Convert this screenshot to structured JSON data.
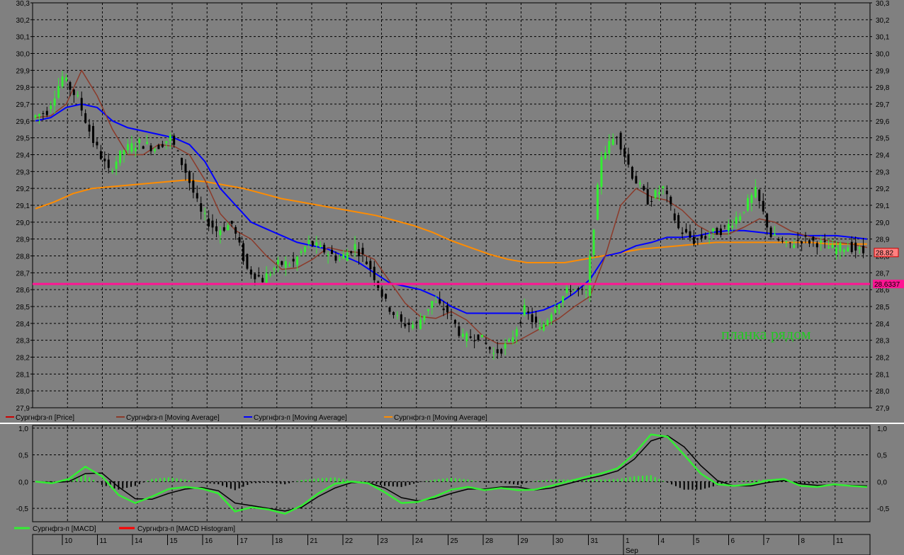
{
  "chart_data": [
    {
      "type": "candlestick",
      "panel": "price",
      "ylim": [
        27.9,
        30.3
      ],
      "yticks": [
        "27,9",
        "28,0",
        "28,1",
        "28,2",
        "28,3",
        "28,4",
        "28,5",
        "28,6",
        "28,7",
        "28,8",
        "28,9",
        "29,0",
        "29,1",
        "29,2",
        "29,3",
        "29,4",
        "29,5",
        "29,6",
        "29,7",
        "29,8",
        "29,9",
        "30,0",
        "30,1",
        "30,2",
        "30,3"
      ],
      "grid": true,
      "price_close": [
        29.62,
        29.66,
        29.86,
        29.73,
        29.48,
        29.3,
        29.43,
        29.47,
        29.44,
        29.5,
        29.3,
        29.05,
        28.95,
        28.99,
        28.72,
        28.66,
        28.75,
        28.76,
        28.88,
        28.83,
        28.78,
        28.86,
        28.73,
        28.52,
        28.4,
        28.39,
        28.53,
        28.47,
        28.31,
        28.33,
        28.22,
        28.28,
        28.48,
        28.36,
        28.51,
        28.61,
        28.57,
        29.4,
        29.52,
        29.28,
        29.13,
        29.2,
        28.96,
        28.89,
        28.93,
        28.96,
        29.05,
        29.18,
        28.92,
        28.86,
        28.9,
        28.88,
        28.84,
        28.86,
        28.82
      ],
      "moving_average_short": [
        29.62,
        29.63,
        29.7,
        29.9,
        29.75,
        29.55,
        29.4,
        29.4,
        29.46,
        29.45,
        29.4,
        29.25,
        29.05,
        28.95,
        28.9,
        28.8,
        28.72,
        28.73,
        28.78,
        28.85,
        28.83,
        28.82,
        28.78,
        28.65,
        28.52,
        28.44,
        28.43,
        28.47,
        28.42,
        28.33,
        28.28,
        28.28,
        28.33,
        28.38,
        28.43,
        28.5,
        28.56,
        28.8,
        29.1,
        29.2,
        29.15,
        29.13,
        29.07,
        28.98,
        28.93,
        28.93,
        28.97,
        29.02,
        29.0,
        28.95,
        28.92,
        28.9,
        28.88,
        28.87,
        28.85
      ],
      "moving_average_medium": [
        29.6,
        29.62,
        29.68,
        29.7,
        29.68,
        29.6,
        29.56,
        29.54,
        29.52,
        29.5,
        29.46,
        29.36,
        29.2,
        29.1,
        29.0,
        28.96,
        28.92,
        28.88,
        28.86,
        28.84,
        28.8,
        28.76,
        28.7,
        28.64,
        28.62,
        28.6,
        28.56,
        28.5,
        28.46,
        28.46,
        28.46,
        28.46,
        28.46,
        28.48,
        28.52,
        28.58,
        28.66,
        28.8,
        28.82,
        28.86,
        28.88,
        28.91,
        28.91,
        28.92,
        28.94,
        28.95,
        28.95,
        28.94,
        28.93,
        28.93,
        28.92,
        28.92,
        28.92,
        28.91,
        28.9
      ],
      "moving_average_long": [
        29.08,
        29.12,
        29.17,
        29.2,
        29.21,
        29.22,
        29.23,
        29.24,
        29.25,
        29.24,
        29.22,
        29.2,
        29.17,
        29.14,
        29.12,
        29.1,
        29.08,
        29.06,
        29.04,
        29.01,
        28.98,
        28.94,
        28.89,
        28.85,
        28.81,
        28.78,
        28.76,
        28.76,
        28.76,
        28.78,
        28.8,
        28.82,
        28.84,
        28.85,
        28.86,
        28.87,
        28.88,
        28.88,
        28.88,
        28.88,
        28.88,
        28.88,
        28.87,
        28.87,
        28.87
      ],
      "current_price_label": "28.82",
      "hline_value": 28.6337,
      "hline_label": "28.6337",
      "annotation": "планка рядом",
      "legend": [
        {
          "label": "Сургнфгз-п [Price]",
          "color": "#cc0000"
        },
        {
          "label": "Сургнфгз-п [Moving Average]",
          "color": "#8b3a2a"
        },
        {
          "label": "Сургнфгз-п [Moving Average]",
          "color": "#0000ff"
        },
        {
          "label": "Сургнфгз-п [Moving Average]",
          "color": "#ff8c00"
        }
      ],
      "colors": {
        "up": "#33ee33",
        "down": "#000000",
        "hline": "#ff1493",
        "ma_short": "#8b3a2a",
        "ma_medium": "#0000ff",
        "ma_long": "#ff8c00"
      }
    },
    {
      "type": "macd",
      "panel": "macd",
      "ylim": [
        -0.75,
        1.05
      ],
      "yticks": [
        "1,0",
        "0,5",
        "0,0",
        "-0,5"
      ],
      "macd": [
        0.0,
        -0.03,
        0.05,
        0.28,
        0.1,
        -0.25,
        -0.4,
        -0.28,
        -0.14,
        -0.1,
        -0.13,
        -0.22,
        -0.56,
        -0.48,
        -0.52,
        -0.6,
        -0.45,
        -0.22,
        -0.04,
        0.0,
        -0.03,
        -0.2,
        -0.4,
        -0.38,
        -0.28,
        -0.15,
        -0.1,
        -0.16,
        -0.12,
        -0.16,
        -0.15,
        -0.08,
        0.0,
        0.08,
        0.15,
        0.25,
        0.52,
        0.88,
        0.84,
        0.5,
        0.15,
        -0.05,
        -0.08,
        -0.05,
        0.02,
        0.05,
        -0.08,
        -0.1,
        -0.05,
        -0.08,
        -0.1
      ],
      "signal": [
        0.0,
        -0.02,
        0.0,
        0.15,
        0.16,
        -0.1,
        -0.32,
        -0.33,
        -0.22,
        -0.14,
        -0.11,
        -0.17,
        -0.4,
        -0.45,
        -0.5,
        -0.55,
        -0.48,
        -0.28,
        -0.12,
        -0.02,
        -0.02,
        -0.12,
        -0.3,
        -0.36,
        -0.32,
        -0.22,
        -0.14,
        -0.14,
        -0.1,
        -0.1,
        -0.16,
        -0.12,
        -0.04,
        0.04,
        0.11,
        0.2,
        0.42,
        0.76,
        0.86,
        0.65,
        0.3,
        0.02,
        -0.08,
        -0.08,
        -0.02,
        0.02,
        -0.04,
        -0.07,
        -0.06,
        -0.07,
        -0.08
      ],
      "histogram": [
        0.0,
        -0.01,
        0.05,
        0.13,
        -0.06,
        -0.15,
        -0.08,
        0.05,
        0.08,
        0.04,
        -0.02,
        -0.05,
        -0.16,
        -0.03,
        -0.02,
        -0.05,
        0.03,
        0.06,
        0.08,
        0.02,
        -0.01,
        -0.08,
        -0.1,
        -0.02,
        0.04,
        0.07,
        0.04,
        -0.02,
        -0.02,
        -0.06,
        0.01,
        0.04,
        0.04,
        0.04,
        0.04,
        0.05,
        0.1,
        0.12,
        -0.02,
        -0.15,
        -0.15,
        -0.07,
        0.0,
        0.03,
        0.04,
        0.03,
        -0.04,
        -0.03,
        0.01,
        -0.01,
        -0.02
      ],
      "legend": [
        {
          "label": "Сургнфгз-п [MACD]",
          "color": "#33ee33"
        },
        {
          "label": "Сургнфгз-п [MACD Histogram]",
          "color": "#ff0000"
        }
      ],
      "colors": {
        "macd": "#33ee33",
        "signal": "#000000",
        "hist_up": "#33ee33",
        "hist_down": "#000000"
      }
    }
  ],
  "x_axis": {
    "day_labels": [
      "10",
      "11",
      "14",
      "15",
      "16",
      "17",
      "18",
      "21",
      "22",
      "23",
      "24",
      "25",
      "28",
      "29",
      "30",
      "31",
      "1",
      "4",
      "5",
      "6",
      "7",
      "8",
      "11"
    ],
    "month_label": "Sep"
  }
}
